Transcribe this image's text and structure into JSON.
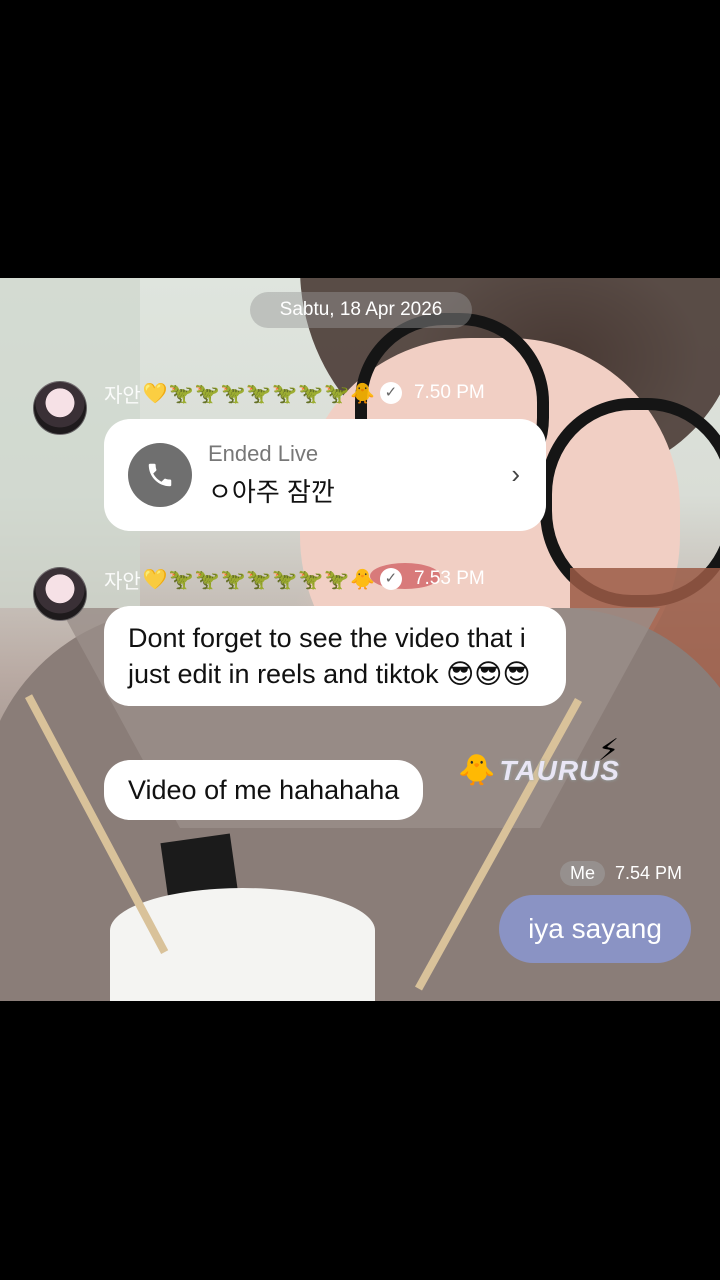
{
  "date_separator": "Sabtu, 18 Apr 2026",
  "messages": [
    {
      "sender_name": "자안",
      "sender_decoration": "💛🦖🦖🦖🦖🦖🦖🦖🐥",
      "time": "7.50 PM",
      "call": {
        "title": "Ended Live",
        "subtitle": "ㅇ아주 잠깐",
        "icon": "phone-icon"
      }
    },
    {
      "sender_name": "자안",
      "sender_decoration": "💛🦖🦖🦖🦖🦖🦖🦖🐥",
      "time": "7.53 PM",
      "bubbles": [
        "Dont forget to see the video that i just edit in reels and tiktok 😎😎😎",
        "Video of me hahahaha"
      ]
    }
  ],
  "my_message": {
    "sender_tag": "Me",
    "time": "7.54 PM",
    "text": "iya sayang",
    "bubble_color": "#8a93c4"
  },
  "sticker": {
    "text": "TAURUS",
    "emoji_left": "🐥",
    "emoji_right": "⚡"
  }
}
